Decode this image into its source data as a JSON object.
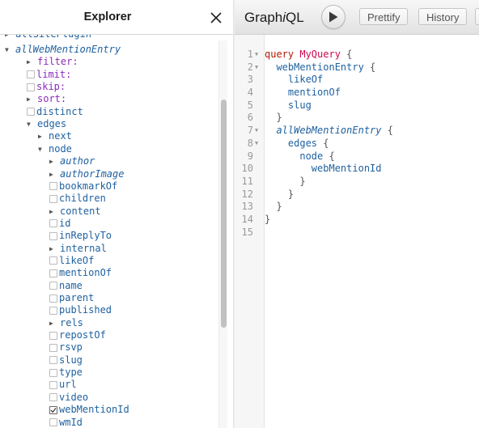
{
  "explorer": {
    "title": "Explorer",
    "close_icon": "close-icon",
    "clipped_top_item": "allSitePlugin",
    "items": [
      {
        "label": "allWebMentionEntry",
        "kind": "expanded",
        "depth": 0,
        "style": "obj"
      },
      {
        "label": "filter:",
        "kind": "collapsed",
        "depth": 1,
        "style": "arg"
      },
      {
        "label": "limit:",
        "kind": "checkbox",
        "depth": 1,
        "style": "arg",
        "checked": false
      },
      {
        "label": "skip:",
        "kind": "checkbox",
        "depth": 1,
        "style": "arg",
        "checked": false
      },
      {
        "label": "sort:",
        "kind": "collapsed",
        "depth": 1,
        "style": "arg"
      },
      {
        "label": "distinct",
        "kind": "checkbox",
        "depth": 1,
        "style": "field",
        "checked": false
      },
      {
        "label": "edges",
        "kind": "expanded",
        "depth": 1,
        "style": "field"
      },
      {
        "label": "next",
        "kind": "collapsed",
        "depth": 2,
        "style": "field"
      },
      {
        "label": "node",
        "kind": "expanded",
        "depth": 2,
        "style": "field"
      },
      {
        "label": "author",
        "kind": "collapsed",
        "depth": 3,
        "style": "obj"
      },
      {
        "label": "authorImage",
        "kind": "collapsed",
        "depth": 3,
        "style": "obj"
      },
      {
        "label": "bookmarkOf",
        "kind": "checkbox",
        "depth": 3,
        "style": "field",
        "checked": false
      },
      {
        "label": "children",
        "kind": "checkbox",
        "depth": 3,
        "style": "field",
        "checked": false
      },
      {
        "label": "content",
        "kind": "collapsed",
        "depth": 3,
        "style": "field"
      },
      {
        "label": "id",
        "kind": "checkbox",
        "depth": 3,
        "style": "field",
        "checked": false
      },
      {
        "label": "inReplyTo",
        "kind": "checkbox",
        "depth": 3,
        "style": "field",
        "checked": false
      },
      {
        "label": "internal",
        "kind": "collapsed",
        "depth": 3,
        "style": "field"
      },
      {
        "label": "likeOf",
        "kind": "checkbox",
        "depth": 3,
        "style": "field",
        "checked": false
      },
      {
        "label": "mentionOf",
        "kind": "checkbox",
        "depth": 3,
        "style": "field",
        "checked": false
      },
      {
        "label": "name",
        "kind": "checkbox",
        "depth": 3,
        "style": "field",
        "checked": false
      },
      {
        "label": "parent",
        "kind": "checkbox",
        "depth": 3,
        "style": "field",
        "checked": false
      },
      {
        "label": "published",
        "kind": "checkbox",
        "depth": 3,
        "style": "field",
        "checked": false
      },
      {
        "label": "rels",
        "kind": "collapsed",
        "depth": 3,
        "style": "field"
      },
      {
        "label": "repostOf",
        "kind": "checkbox",
        "depth": 3,
        "style": "field",
        "checked": false
      },
      {
        "label": "rsvp",
        "kind": "checkbox",
        "depth": 3,
        "style": "field",
        "checked": false
      },
      {
        "label": "slug",
        "kind": "checkbox",
        "depth": 3,
        "style": "field",
        "checked": false
      },
      {
        "label": "type",
        "kind": "checkbox",
        "depth": 3,
        "style": "field",
        "checked": false
      },
      {
        "label": "url",
        "kind": "checkbox",
        "depth": 3,
        "style": "field",
        "checked": false
      },
      {
        "label": "video",
        "kind": "checkbox",
        "depth": 3,
        "style": "field",
        "checked": false
      },
      {
        "label": "webMentionId",
        "kind": "checkbox",
        "depth": 3,
        "style": "field",
        "checked": true
      },
      {
        "label": "wmId",
        "kind": "checkbox",
        "depth": 3,
        "style": "field",
        "checked": false
      }
    ]
  },
  "toolbar": {
    "logo_prefix": "Graph",
    "logo_i": "i",
    "logo_suffix": "QL",
    "run_icon": "play-icon",
    "prettify_label": "Prettify",
    "history_label": "History"
  },
  "editor": {
    "lines": [
      {
        "n": "1",
        "fold": true,
        "tokens": [
          [
            "kw",
            "query"
          ],
          [
            "plain",
            " "
          ],
          [
            "def",
            "MyQuery"
          ],
          [
            "punc",
            " {"
          ]
        ]
      },
      {
        "n": "2",
        "fold": true,
        "tokens": [
          [
            "plain",
            "  "
          ],
          [
            "prop",
            "webMentionEntry"
          ],
          [
            "punc",
            " {"
          ]
        ]
      },
      {
        "n": "3",
        "fold": false,
        "tokens": [
          [
            "plain",
            "    "
          ],
          [
            "prop",
            "likeOf"
          ]
        ]
      },
      {
        "n": "4",
        "fold": false,
        "tokens": [
          [
            "plain",
            "    "
          ],
          [
            "prop",
            "mentionOf"
          ]
        ]
      },
      {
        "n": "5",
        "fold": false,
        "tokens": [
          [
            "plain",
            "    "
          ],
          [
            "prop",
            "slug"
          ]
        ]
      },
      {
        "n": "6",
        "fold": false,
        "tokens": [
          [
            "plain",
            "  "
          ],
          [
            "punc",
            "}"
          ]
        ]
      },
      {
        "n": "7",
        "fold": true,
        "tokens": [
          [
            "plain",
            "  "
          ],
          [
            "prop italic",
            "allWebMentionEntry"
          ],
          [
            "punc",
            " {"
          ]
        ]
      },
      {
        "n": "8",
        "fold": true,
        "tokens": [
          [
            "plain",
            "    "
          ],
          [
            "prop",
            "edges"
          ],
          [
            "punc",
            " {"
          ]
        ]
      },
      {
        "n": "9",
        "fold": false,
        "tokens": [
          [
            "plain",
            "      "
          ],
          [
            "prop",
            "node"
          ],
          [
            "punc",
            " {"
          ]
        ]
      },
      {
        "n": "10",
        "fold": false,
        "tokens": [
          [
            "plain",
            "        "
          ],
          [
            "prop",
            "webMentionId"
          ]
        ]
      },
      {
        "n": "11",
        "fold": false,
        "tokens": [
          [
            "plain",
            "      "
          ],
          [
            "punc",
            "}"
          ]
        ]
      },
      {
        "n": "12",
        "fold": false,
        "tokens": [
          [
            "plain",
            "    "
          ],
          [
            "punc",
            "}"
          ]
        ]
      },
      {
        "n": "13",
        "fold": false,
        "tokens": [
          [
            "plain",
            "  "
          ],
          [
            "punc",
            "}"
          ]
        ]
      },
      {
        "n": "14",
        "fold": false,
        "tokens": [
          [
            "punc",
            "}"
          ]
        ]
      },
      {
        "n": "15",
        "fold": false,
        "tokens": []
      }
    ]
  },
  "colors": {
    "field": "#1f61a0",
    "argument": "#8b2bb9",
    "keyword": "#b11a04",
    "definition": "#d2054e"
  }
}
